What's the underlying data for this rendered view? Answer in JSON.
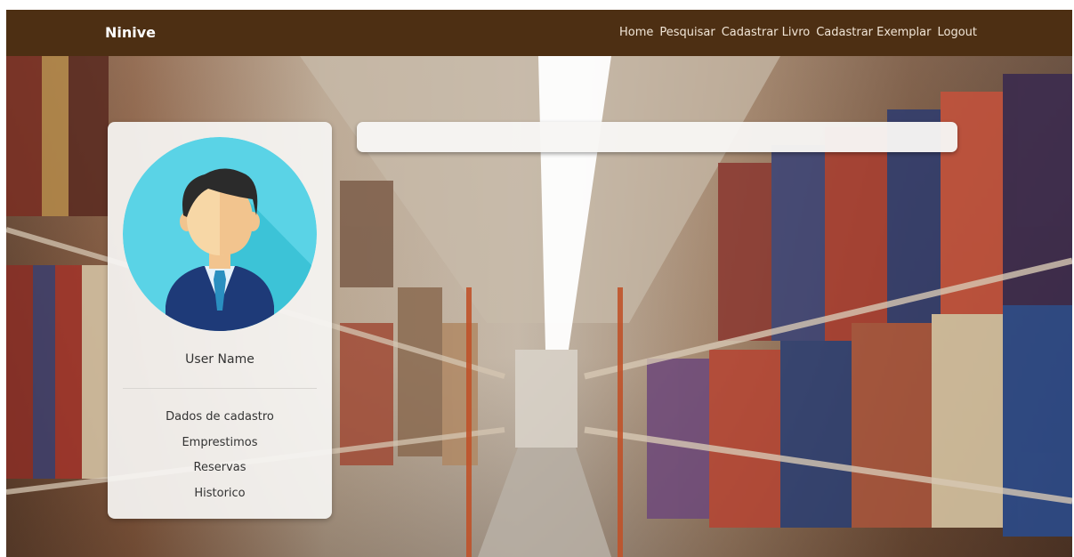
{
  "navbar": {
    "brand": "Ninive",
    "links": [
      "Home",
      "Pesquisar",
      "Cadastrar Livro",
      "Cadastrar Exemplar",
      "Logout"
    ]
  },
  "search": {
    "value": "",
    "placeholder": ""
  },
  "profile": {
    "user_name": "User Name",
    "menu": [
      "Dados de cadastro",
      "Emprestimos",
      "Reservas",
      "Historico"
    ]
  },
  "colors": {
    "navbar_bg": "#4d2f13",
    "avatar_bg": "#5ad3e6",
    "card_bg": "#f6f5f3"
  },
  "icons": {
    "avatar": "user-avatar-icon"
  }
}
